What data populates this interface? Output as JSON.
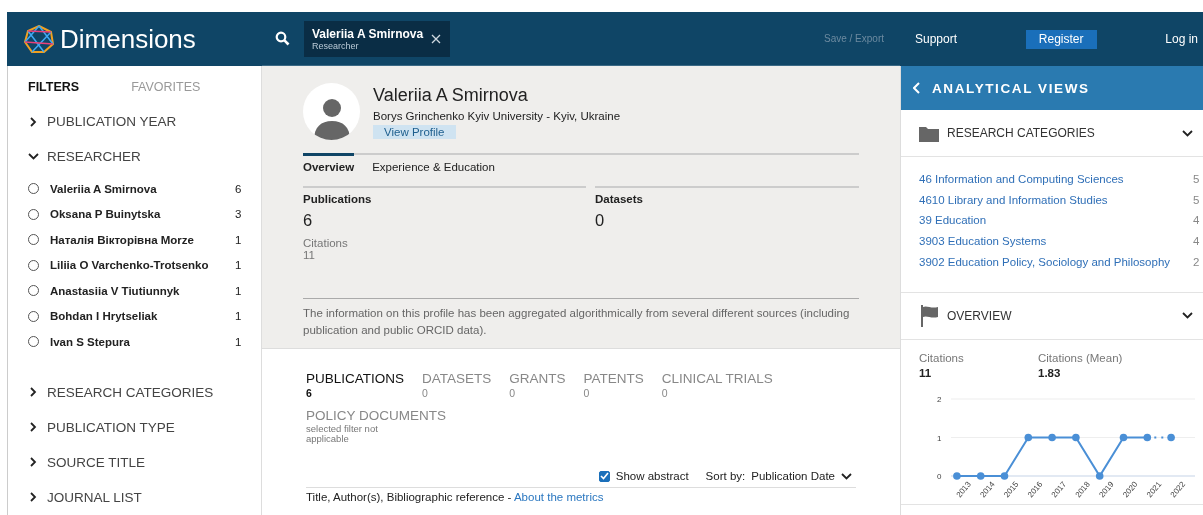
{
  "header": {
    "logo": "Dimensions",
    "search_chip": {
      "title": "Valeriia A Smirnova",
      "subtitle": "Researcher"
    },
    "save_export": {
      "label": "Save / Export",
      "disabled": true
    },
    "support": "Support",
    "register": "Register",
    "login": "Log in"
  },
  "filters": {
    "tabs": [
      {
        "label": "FILTERS",
        "selected": true
      },
      {
        "label": "FAVORITES",
        "selected": false
      }
    ],
    "sections": [
      {
        "label": "PUBLICATION YEAR",
        "expanded": false
      },
      {
        "label": "RESEARCHER",
        "expanded": true,
        "items": [
          {
            "name": "Valeriia A Smirnova",
            "count": "6",
            "selected": false
          },
          {
            "name": "Oksana P Buinytska",
            "count": "3",
            "selected": false
          },
          {
            "name": "Наталія Вікторівна Morze",
            "count": "1",
            "selected": false
          },
          {
            "name": "Liliia O Varchenko-Trotsenko",
            "count": "1",
            "selected": false
          },
          {
            "name": "Anastasiia V Tiutiunnyk",
            "count": "1",
            "selected": false
          },
          {
            "name": "Bohdan I Hrytseliak",
            "count": "1",
            "selected": false
          },
          {
            "name": "Ivan S Stepura",
            "count": "1",
            "selected": false
          }
        ]
      },
      {
        "label": "RESEARCH CATEGORIES",
        "expanded": false
      },
      {
        "label": "PUBLICATION TYPE",
        "expanded": false
      },
      {
        "label": "SOURCE TITLE",
        "expanded": false
      },
      {
        "label": "JOURNAL LIST",
        "expanded": false
      }
    ]
  },
  "profile": {
    "name": "Valeriia A Smirnova",
    "affiliation": "Borys Grinchenko Kyiv University - Kyiv, Ukraine",
    "view_profile": "View Profile",
    "tabs": [
      {
        "label": "Overview",
        "selected": true
      },
      {
        "label": "Experience & Education",
        "selected": false
      }
    ],
    "stats": [
      {
        "label": "Publications",
        "value": "6",
        "sub_label": "Citations",
        "sub_value": "11"
      },
      {
        "label": "Datasets",
        "value": "0"
      }
    ],
    "note": "The information on this profile has been aggregated algorithmically from several different sources (including publication and public ORCID data)."
  },
  "results": {
    "tabs": [
      {
        "label": "PUBLICATIONS",
        "count": "6",
        "selected": true
      },
      {
        "label": "DATASETS",
        "count": "0",
        "selected": false
      },
      {
        "label": "GRANTS",
        "count": "0",
        "selected": false
      },
      {
        "label": "PATENTS",
        "count": "0",
        "selected": false
      },
      {
        "label": "CLINICAL TRIALS",
        "count": "0",
        "selected": false
      },
      {
        "label": "POLICY DOCUMENTS",
        "note": "selected filter not applicable",
        "selected": false
      }
    ],
    "show_abstract": {
      "label": "Show abstract",
      "checked": true
    },
    "sort": {
      "label": "Sort by:",
      "value": "Publication Date"
    },
    "columns_line": "Title, Author(s), Bibliographic reference -",
    "metrics_link": "About the metrics"
  },
  "analytics": {
    "title": "ANALYTICAL VIEWS",
    "panels": [
      {
        "kind": "categories",
        "title": "RESEARCH CATEGORIES",
        "expanded": true,
        "items": [
          {
            "label": "46 Information and Computing Sciences",
            "count": "5"
          },
          {
            "label": "4610 Library and Information Studies",
            "count": "5"
          },
          {
            "label": "39 Education",
            "count": "4"
          },
          {
            "label": "3903 Education Systems",
            "count": "4"
          },
          {
            "label": "3902 Education Policy, Sociology and Philosophy",
            "count": "2"
          }
        ]
      },
      {
        "kind": "overview",
        "title": "OVERVIEW",
        "expanded": true,
        "metrics": [
          {
            "label": "Citations",
            "value": "11"
          },
          {
            "label": "Citations (Mean)",
            "value": "1.83"
          }
        ],
        "chart_data": {
          "type": "line",
          "categories": [
            "2013",
            "2014",
            "2015",
            "2016",
            "2017",
            "2018",
            "2019",
            "2020",
            "2021",
            "2022"
          ],
          "ylim": [
            0,
            2
          ],
          "yticks": [
            0,
            1,
            2
          ],
          "series": [
            {
              "color": "#4a8fd6",
              "marker": true,
              "values": [
                0,
                0,
                0,
                1,
                1,
                1,
                0,
                1,
                1,
                1
              ]
            }
          ]
        }
      }
    ]
  }
}
